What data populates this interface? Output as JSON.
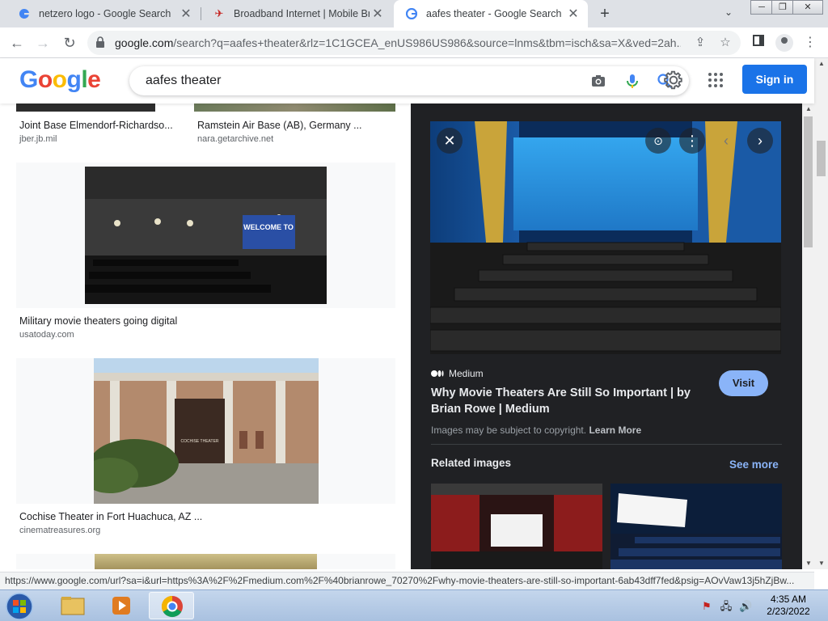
{
  "browser": {
    "tabs": [
      {
        "title": "netzero logo - Google Search",
        "favicon": "G",
        "active": false
      },
      {
        "title": "Broadband Internet | Mobile Broa",
        "favicon": "✈",
        "active": false
      },
      {
        "title": "aafes theater - Google Search",
        "favicon": "G",
        "active": true
      }
    ],
    "new_tab": "+",
    "url_host": "google.com",
    "url_rest": "/search?q=aafes+theater&rlz=1C1GCEA_enUS986US986&source=lnms&tbm=isch&sa=X&ved=2ah..."
  },
  "google": {
    "logo": "Google",
    "query": "aafes theater",
    "signin_label": "Sign in"
  },
  "results": [
    {
      "title": "Joint Base Elmendorf-Richardso...",
      "source": "jber.jb.mil"
    },
    {
      "title": "Ramstein Air Base (AB), Germany ...",
      "source": "nara.getarchive.net"
    },
    {
      "title": "Military movie theaters going digital",
      "source": "usatoday.com",
      "img_text": "WELCOME TO"
    },
    {
      "title": "Cochise Theater in Fort Huachuca, AZ ...",
      "source": "cinematreasures.org",
      "img_text": "COCHISE THEATER"
    }
  ],
  "panel": {
    "source": "Medium",
    "title": "Why Movie Theaters Are Still So Important | by Brian Rowe | Medium",
    "visit_label": "Visit",
    "copyright": "Images may be subject to copyright.",
    "learn_more": "Learn More",
    "related_label": "Related images",
    "see_more_label": "See more"
  },
  "status_url": "https://www.google.com/url?sa=i&url=https%3A%2F%2Fmedium.com%2F%40brianrowe_70270%2Fwhy-movie-theaters-are-still-so-important-6ab43dff7fed&psig=AOvVaw13j5hZjBw...",
  "taskbar": {
    "time": "4:35 AM",
    "date": "2/23/2022"
  },
  "colors": {
    "google_blue": "#4285F4",
    "google_red": "#EA4335",
    "google_yellow": "#FBBC05",
    "google_green": "#34A853",
    "signin_bg": "#1a73e8",
    "panel_bg": "#202124",
    "visit_bg": "#8ab4f8"
  }
}
